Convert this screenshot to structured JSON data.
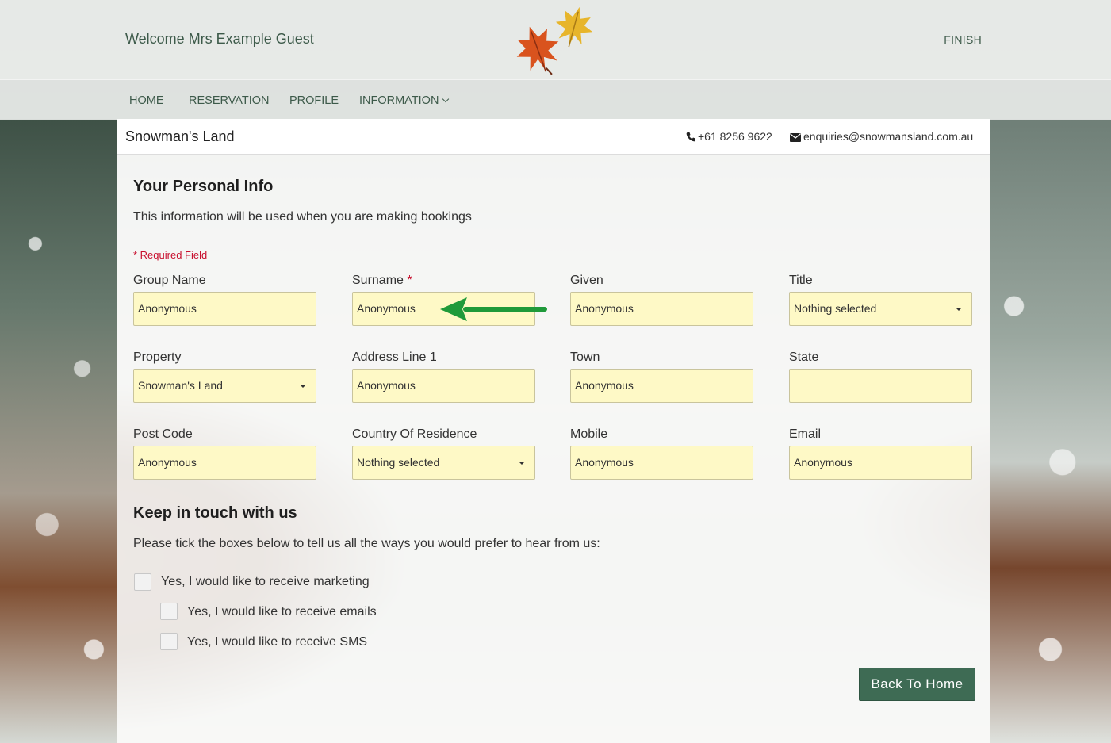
{
  "header": {
    "welcome": "Welcome Mrs Example Guest",
    "finish": "FINISH",
    "logo_icon": "autumn-leaves-logo"
  },
  "nav": {
    "items": [
      "HOME",
      "RESERVATION",
      "PROFILE",
      "INFORMATION"
    ]
  },
  "property_bar": {
    "name": "Snowman's Land",
    "phone": "+61 8256 9622",
    "email": "enquiries@snowmansland.com.au"
  },
  "personal": {
    "title": "Your Personal Info",
    "subtitle": "This information will be used when you are making bookings",
    "required_note": "* Required Field",
    "fields": [
      {
        "label": "Group Name",
        "value": "Anonymous",
        "type": "text"
      },
      {
        "label": "Surname",
        "value": "Anonymous",
        "type": "text",
        "required": true
      },
      {
        "label": "Given",
        "value": "Anonymous",
        "type": "text"
      },
      {
        "label": "Title",
        "value": "Nothing selected",
        "type": "select"
      },
      {
        "label": "Property",
        "value": "Snowman's Land",
        "type": "select"
      },
      {
        "label": "Address Line 1",
        "value": "Anonymous",
        "type": "text"
      },
      {
        "label": "Town",
        "value": "Anonymous",
        "type": "text"
      },
      {
        "label": "State",
        "value": "",
        "type": "text"
      },
      {
        "label": "Post Code",
        "value": "Anonymous",
        "type": "text"
      },
      {
        "label": "Country Of Residence",
        "value": "Nothing selected",
        "type": "select"
      },
      {
        "label": "Mobile",
        "value": "Anonymous",
        "type": "text"
      },
      {
        "label": "Email",
        "value": "Anonymous",
        "type": "text"
      }
    ]
  },
  "touch": {
    "title": "Keep in touch with us",
    "subtitle": "Please tick the boxes below to tell us all the ways you would prefer to hear from us:",
    "options": [
      "Yes, I would like to receive marketing",
      "Yes, I would like to receive emails",
      "Yes, I would like to receive SMS"
    ]
  },
  "actions": {
    "back_home": "Back To Home"
  },
  "colors": {
    "accent": "#3e6b54",
    "field_bg": "#fef9c6",
    "required": "#c8102e",
    "annotation_arrow": "#1f9a3a"
  }
}
